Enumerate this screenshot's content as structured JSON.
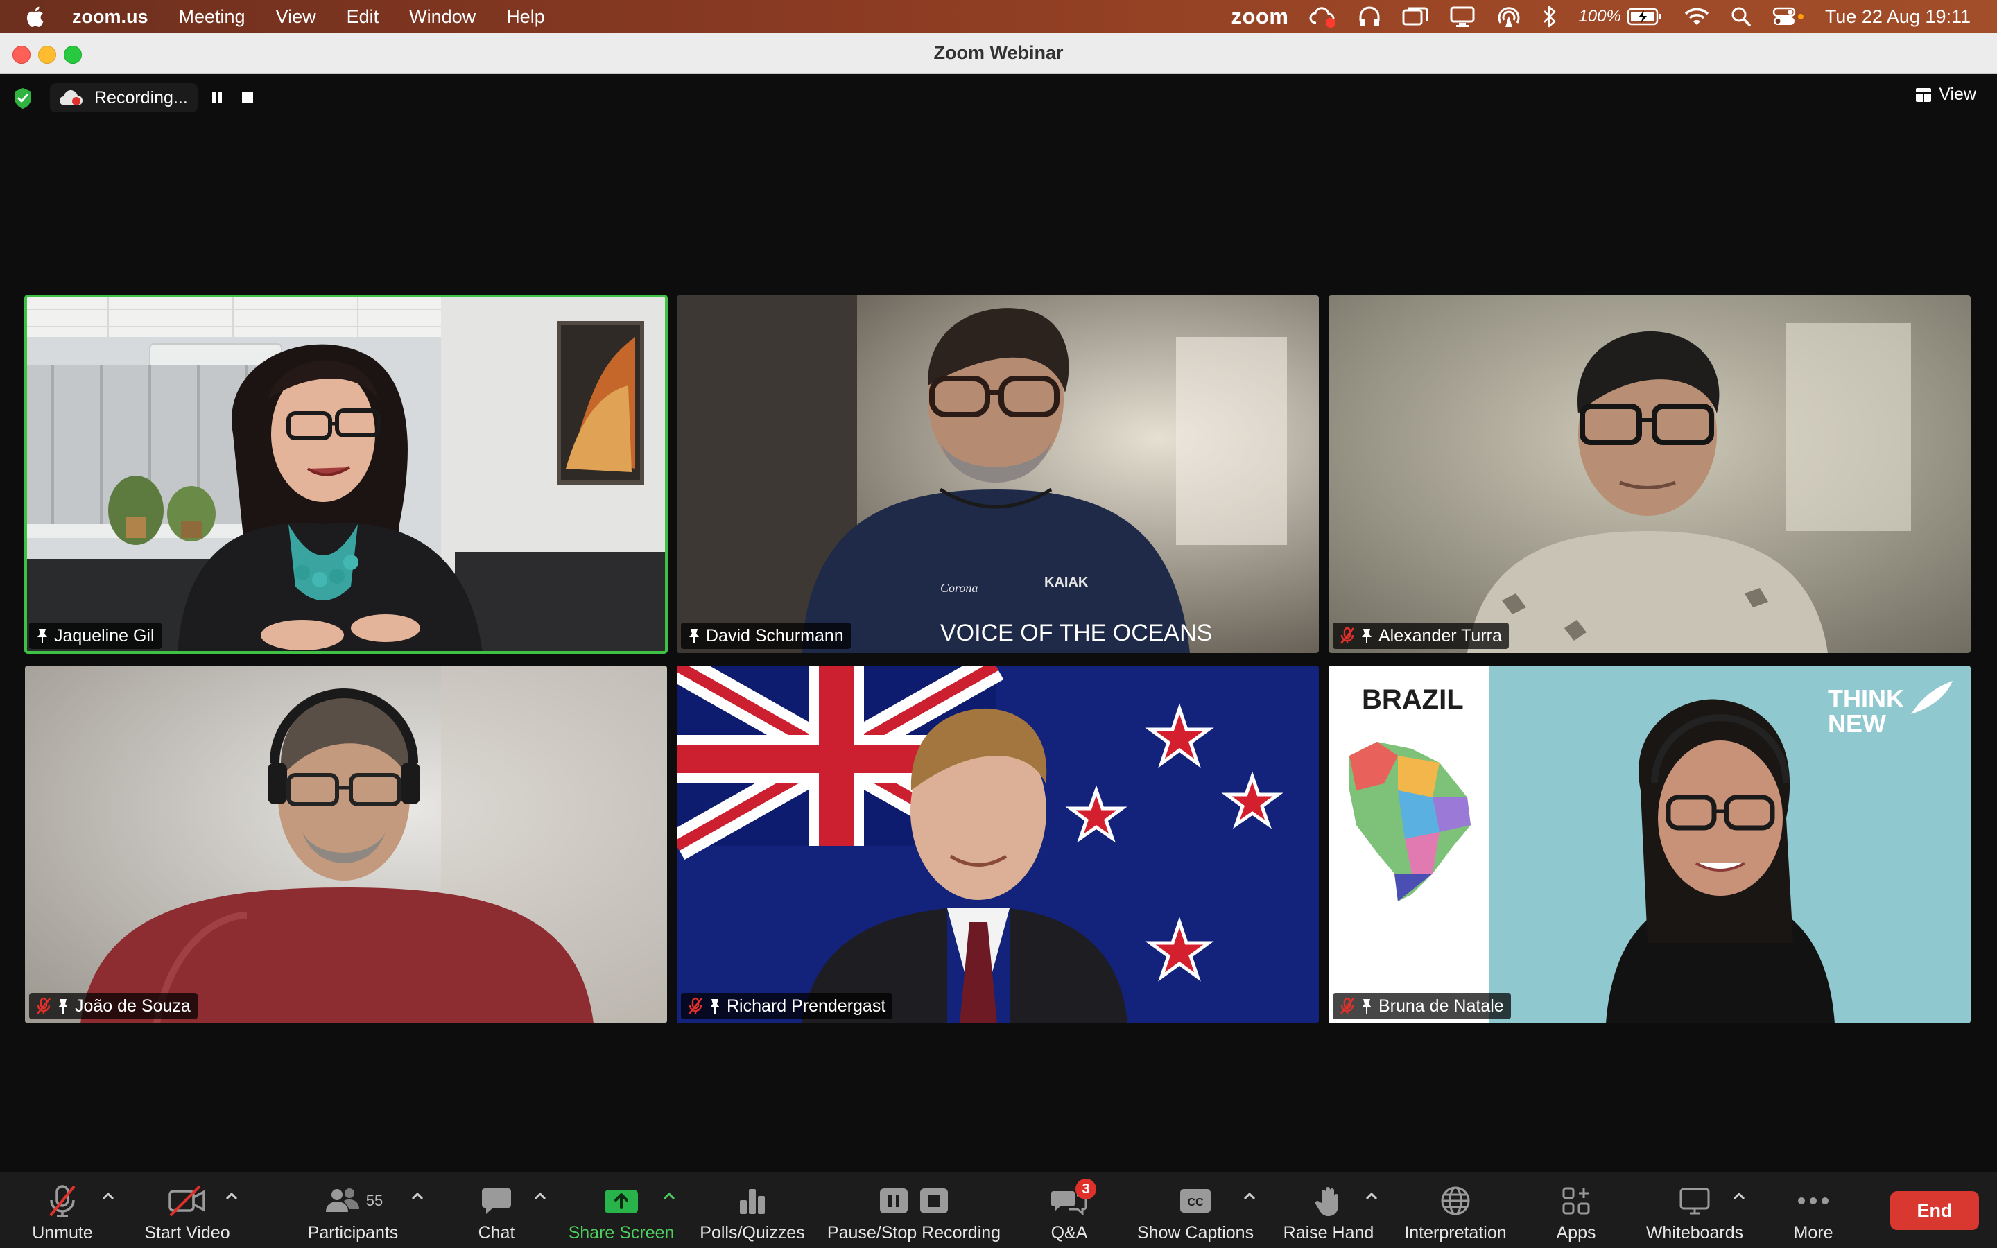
{
  "menubar": {
    "app_name": "zoom.us",
    "menus": [
      "Meeting",
      "View",
      "Edit",
      "Window",
      "Help"
    ],
    "zoom_label": "zoom",
    "battery": "100%",
    "clock": "Tue 22 Aug  19:11"
  },
  "window": {
    "title": "Zoom Webinar"
  },
  "recording": {
    "label": "Recording..."
  },
  "view_button": "View",
  "participants": [
    {
      "name": "Jaqueline Gil",
      "muted": false,
      "active_speaker": true
    },
    {
      "name": "David Schurmann",
      "muted": false,
      "active_speaker": false
    },
    {
      "name": "Alexander Turra",
      "muted": true,
      "active_speaker": false
    },
    {
      "name": "João de Souza",
      "muted": true,
      "active_speaker": false
    },
    {
      "name": "Richard Prendergast",
      "muted": true,
      "active_speaker": false
    },
    {
      "name": "Bruna de Natale",
      "muted": true,
      "active_speaker": false
    }
  ],
  "tile_text": {
    "shirt": "VOICE OF THE OCEANS",
    "brazil": "BRAZIL",
    "think_new": [
      "THINK",
      "NEW"
    ]
  },
  "toolbar": {
    "unmute": "Unmute",
    "start_video": "Start Video",
    "participants": "Participants",
    "participants_count": "55",
    "chat": "Chat",
    "share_screen": "Share Screen",
    "polls": "Polls/Quizzes",
    "pause_stop": "Pause/Stop Recording",
    "qa": "Q&A",
    "qa_badge": "3",
    "captions": "Show Captions",
    "raise_hand": "Raise Hand",
    "interpretation": "Interpretation",
    "apps": "Apps",
    "whiteboards": "Whiteboards",
    "more": "More",
    "end": "End"
  },
  "colors": {
    "accent_green": "#3fc145",
    "end_red": "#d93831",
    "badge_red": "#e0302b"
  }
}
